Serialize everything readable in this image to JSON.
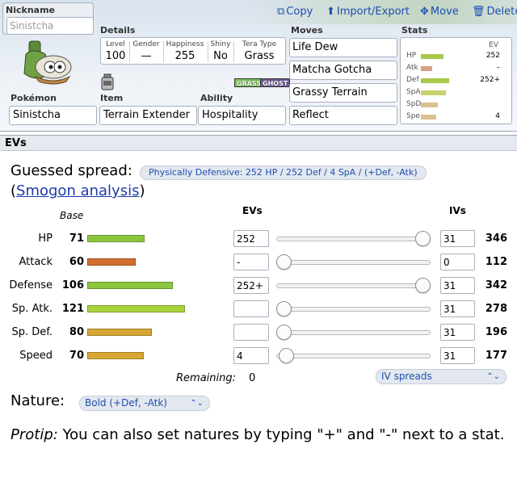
{
  "top": {
    "nickname_label": "Nickname",
    "nickname_placeholder": "Sinistcha",
    "toolbar": {
      "copy": "Copy",
      "import_export": "Import/Export",
      "move": "Move",
      "delete": "Delete"
    },
    "details_label": "Details",
    "details": [
      {
        "label": "Level",
        "value": "100"
      },
      {
        "label": "Gender",
        "value": "—"
      },
      {
        "label": "Happiness",
        "value": "255"
      },
      {
        "label": "Shiny",
        "value": "No"
      },
      {
        "label": "Tera Type",
        "value": "Grass"
      }
    ],
    "types": [
      {
        "name": "GRASS",
        "color": "#78c850"
      },
      {
        "name": "GHOST",
        "color": "#705898"
      }
    ],
    "pokemon_label": "Pokémon",
    "pokemon": "Sinistcha",
    "item_label": "Item",
    "item": "Terrain Extender",
    "ability_label": "Ability",
    "ability": "Hospitality",
    "moves_label": "Moves",
    "moves": [
      "Life Dew",
      "Matcha Gotcha",
      "Grassy Terrain",
      "Reflect"
    ],
    "stats_label": "Stats",
    "stats_ev_header": "EV",
    "stats": [
      {
        "name": "HP",
        "ev": "252",
        "fill": 0.55,
        "color": "#a8c84a"
      },
      {
        "name": "Atk",
        "ev": "–",
        "fill": 0.28,
        "color": "#d8a088"
      },
      {
        "name": "Def",
        "ev": "252+",
        "fill": 0.7,
        "color": "#a8c84a"
      },
      {
        "name": "SpA",
        "ev": "",
        "fill": 0.62,
        "color": "#c8d070"
      },
      {
        "name": "SpD",
        "ev": "",
        "fill": 0.42,
        "color": "#d8c090"
      },
      {
        "name": "Spe",
        "ev": "4",
        "fill": 0.38,
        "color": "#d8c090"
      }
    ]
  },
  "evs": {
    "header": "EVs",
    "guessed_label": "Guessed spread:",
    "guessed_value": "Physically Defensive: 252 HP / 252 Def / 4 SpA / (+Def, -Atk)",
    "smogon_open": "(",
    "smogon_link": "Smogon analysis",
    "smogon_close": ")",
    "col_base": "Base",
    "col_evs": "EVs",
    "col_ivs": "IVs",
    "rows": [
      {
        "name": "HP",
        "base": "71",
        "base_fill": 71,
        "bar_color": "#8cc63f",
        "ev": "252",
        "slider": 1.0,
        "iv": "31",
        "total": "346"
      },
      {
        "name": "Attack",
        "base": "60",
        "base_fill": 60,
        "bar_color": "#d16f2e",
        "ev": "-",
        "slider": 0.0,
        "iv": "0",
        "total": "112"
      },
      {
        "name": "Defense",
        "base": "106",
        "base_fill": 106,
        "bar_color": "#8cc63f",
        "ev": "252+",
        "slider": 1.0,
        "iv": "31",
        "total": "342"
      },
      {
        "name": "Sp. Atk.",
        "base": "121",
        "base_fill": 121,
        "bar_color": "#a9d33d",
        "ev": "",
        "slider": 0.0,
        "iv": "31",
        "total": "278"
      },
      {
        "name": "Sp. Def.",
        "base": "80",
        "base_fill": 80,
        "bar_color": "#d8a735",
        "ev": "",
        "slider": 0.0,
        "iv": "31",
        "total": "196"
      },
      {
        "name": "Speed",
        "base": "70",
        "base_fill": 70,
        "bar_color": "#d8a735",
        "ev": "4",
        "slider": 0.016,
        "iv": "31",
        "total": "177"
      }
    ],
    "remaining_label": "Remaining:",
    "remaining_value": "0",
    "iv_spreads": "IV spreads",
    "nature_label": "Nature:",
    "nature_value": "Bold (+Def, -Atk)",
    "protip_label": "Protip:",
    "protip_text": " You can also set natures by typing \"+\" and \"-\" next to a stat."
  }
}
